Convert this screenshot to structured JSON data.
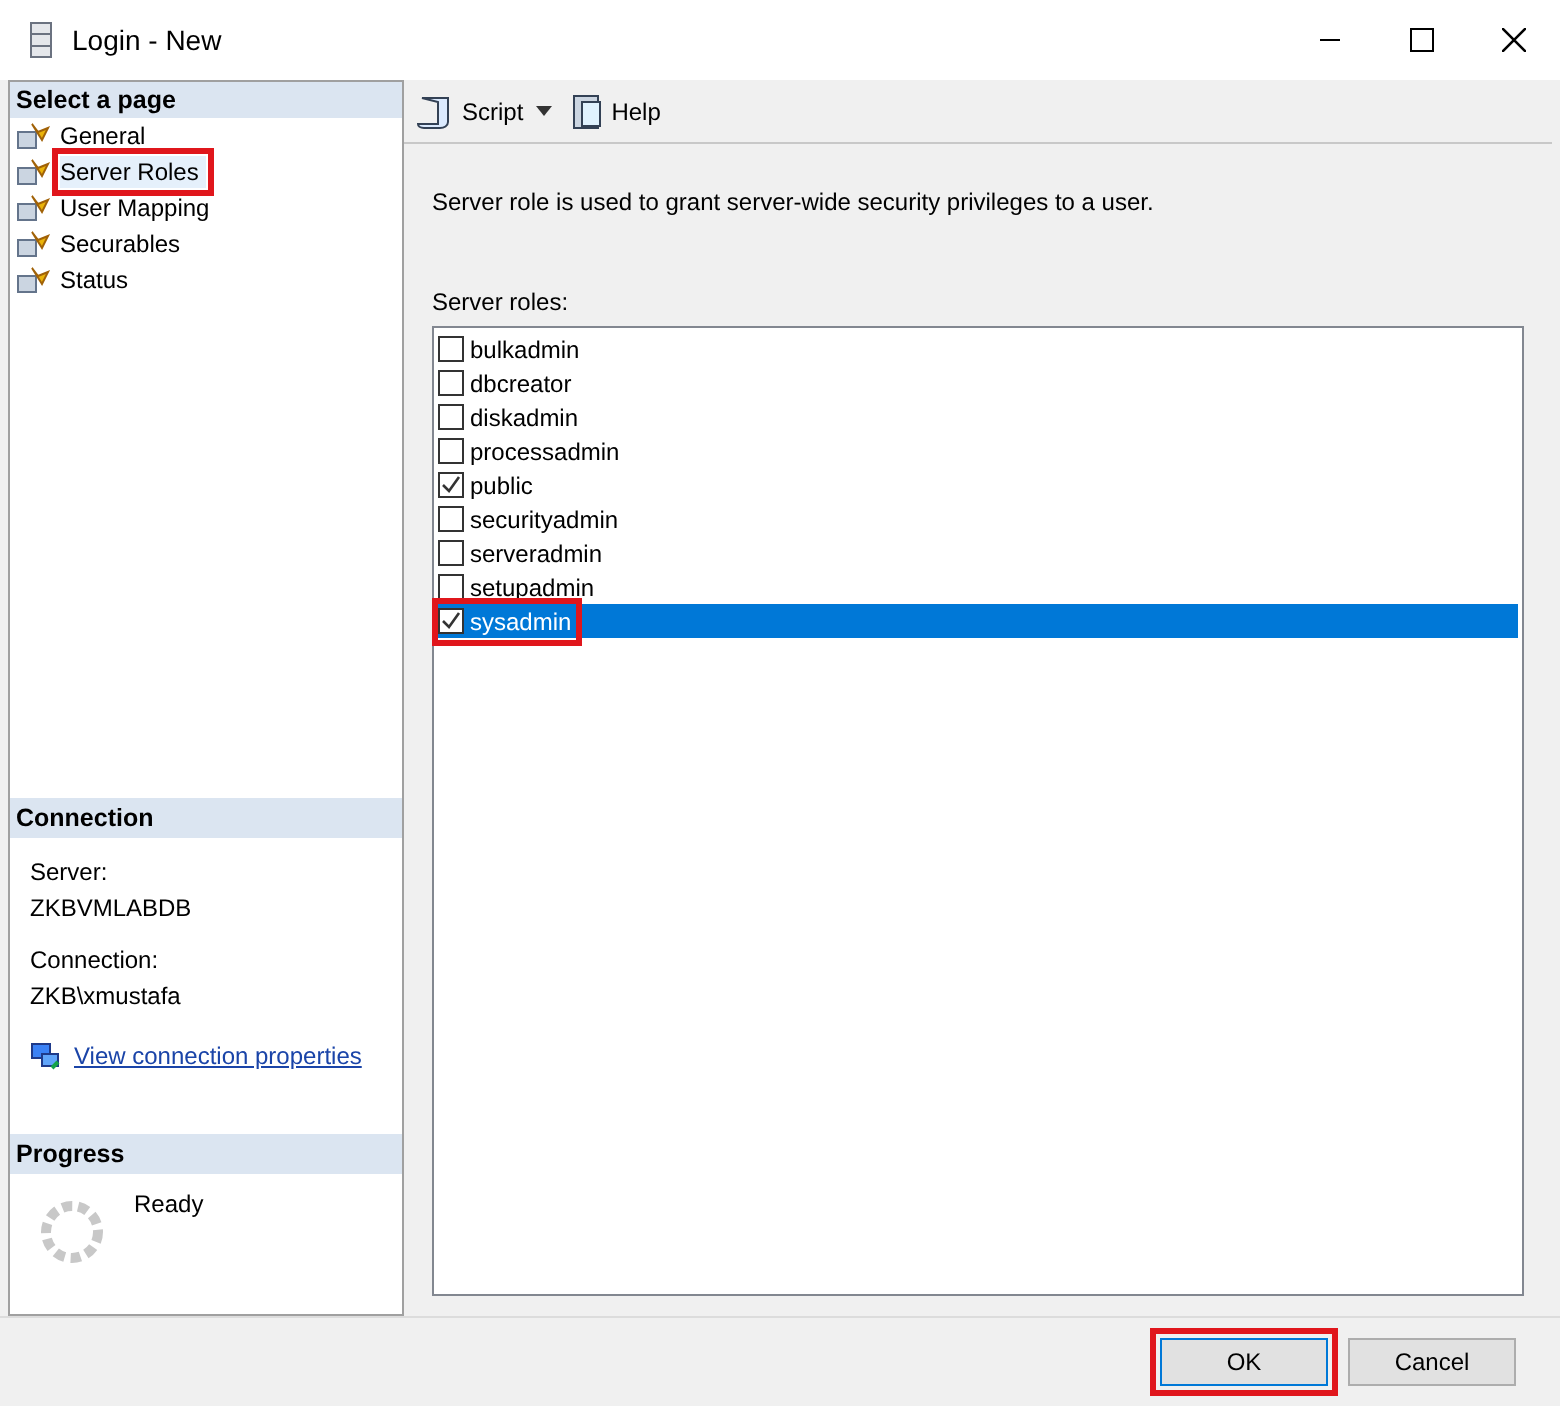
{
  "window": {
    "title": "Login - New"
  },
  "sidebar": {
    "heading": "Select a page",
    "items": [
      {
        "label": "General",
        "selected": false,
        "highlighted": false
      },
      {
        "label": "Server Roles",
        "selected": true,
        "highlighted": true
      },
      {
        "label": "User Mapping",
        "selected": false,
        "highlighted": false
      },
      {
        "label": "Securables",
        "selected": false,
        "highlighted": false
      },
      {
        "label": "Status",
        "selected": false,
        "highlighted": false
      }
    ]
  },
  "connection": {
    "heading": "Connection",
    "server_label": "Server:",
    "server": "ZKBVMLABDB",
    "connection_label": "Connection:",
    "connection": "ZKB\\xmustafa",
    "link": "View connection properties"
  },
  "progress": {
    "heading": "Progress",
    "status": "Ready"
  },
  "toolbar": {
    "script": "Script",
    "help": "Help"
  },
  "description": "Server role is used to grant server-wide security privileges to a user.",
  "roles_label": "Server roles:",
  "roles": [
    {
      "name": "bulkadmin",
      "checked": false,
      "selected": false,
      "highlighted": false
    },
    {
      "name": "dbcreator",
      "checked": false,
      "selected": false,
      "highlighted": false
    },
    {
      "name": "diskadmin",
      "checked": false,
      "selected": false,
      "highlighted": false
    },
    {
      "name": "processadmin",
      "checked": false,
      "selected": false,
      "highlighted": false
    },
    {
      "name": "public",
      "checked": true,
      "selected": false,
      "highlighted": false
    },
    {
      "name": "securityadmin",
      "checked": false,
      "selected": false,
      "highlighted": false
    },
    {
      "name": "serveradmin",
      "checked": false,
      "selected": false,
      "highlighted": false
    },
    {
      "name": "setupadmin",
      "checked": false,
      "selected": false,
      "highlighted": false
    },
    {
      "name": "sysadmin",
      "checked": true,
      "selected": true,
      "highlighted": true
    }
  ],
  "buttons": [
    {
      "label": "OK",
      "highlighted": true
    },
    {
      "label": "Cancel",
      "highlighted": false
    }
  ]
}
